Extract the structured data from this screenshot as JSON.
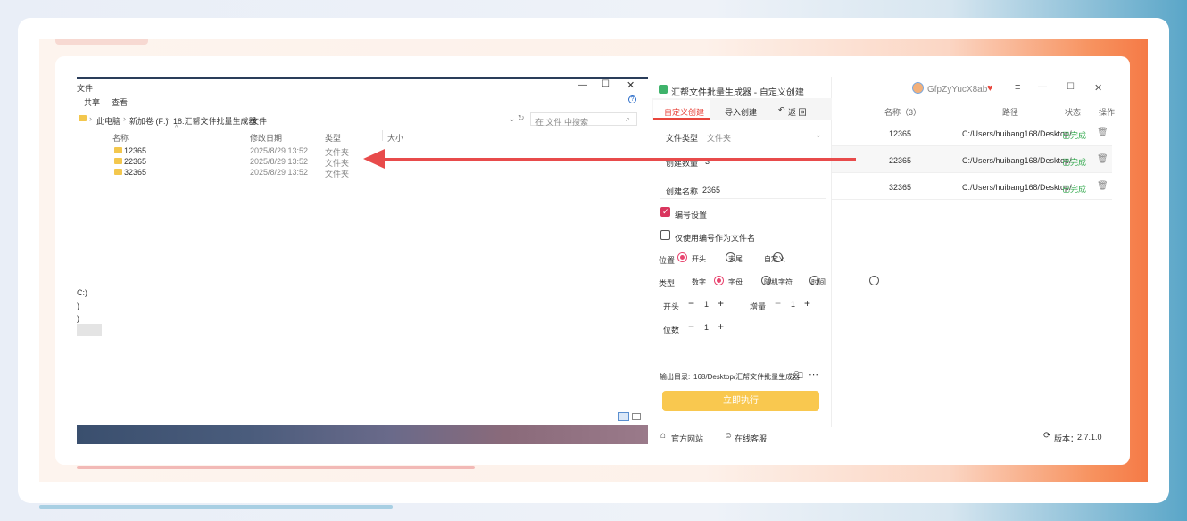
{
  "explorer": {
    "title": "文件",
    "ribbon": [
      "共享",
      "查看"
    ],
    "breadcrumb": [
      "此电脑",
      "新加卷 (F:)",
      "18.汇帮文件批量生成器",
      "文件"
    ],
    "search_placeholder": "在 文件 中搜索",
    "columns": [
      "名称",
      "修改日期",
      "类型",
      "大小"
    ],
    "rows": [
      {
        "name": "12365",
        "date": "2025/8/29 13:52",
        "type": "文件夹"
      },
      {
        "name": "22365",
        "date": "2025/8/29 13:52",
        "type": "文件夹"
      },
      {
        "name": "32365",
        "date": "2025/8/29 13:52",
        "type": "文件夹"
      }
    ],
    "side_fragments": [
      "C:)",
      ")",
      ")"
    ]
  },
  "app": {
    "title": "汇帮文件批量生成器 - 自定义创建",
    "user": "GfpZyYucX8ab",
    "tabs": {
      "custom": "自定义创建",
      "import": "导入创建",
      "back": "返 回"
    },
    "form": {
      "file_type_label": "文件类型",
      "file_type_value": "文件夹",
      "count_label": "创建数量",
      "count_value": "3",
      "name_label": "创建名称",
      "name_value": "2365",
      "numbering_label": "编号设置",
      "only_number_label": "仅使用编号作为文件名",
      "position_label": "位置",
      "position_options": [
        "开头",
        "末尾",
        "自定义"
      ],
      "type_label": "类型",
      "type_options": [
        "数字",
        "字母",
        "随机字符",
        "时间"
      ],
      "start_label": "开头",
      "start_value": "1",
      "step_label": "增量",
      "step_value": "1",
      "digits_label": "位数",
      "digits_value": "1"
    },
    "output_label": "输出目录:",
    "output_path": "168/Desktop/汇帮文件批量生成器",
    "execute_label": "立即执行",
    "table": {
      "col_name": "名称（3）",
      "col_path": "路径",
      "col_status": "状态",
      "col_action": "操作",
      "rows": [
        {
          "name": "12365",
          "path": "C:/Users/huibang168/Desktop/",
          "status": "已完成"
        },
        {
          "name": "22365",
          "path": "C:/Users/huibang168/Desktop/",
          "status": "已完成"
        },
        {
          "name": "32365",
          "path": "C:/Users/huibang168/Desktop/",
          "status": "已完成"
        }
      ]
    },
    "footer": {
      "website": "官方网站",
      "support": "在线客服",
      "version_label": "版本：",
      "version": "2.7.1.0"
    }
  },
  "colors": {
    "accent": "#e8453c",
    "execute": "#f9c84f",
    "done": "#2fa84b",
    "arrow": "#e84b4b"
  }
}
